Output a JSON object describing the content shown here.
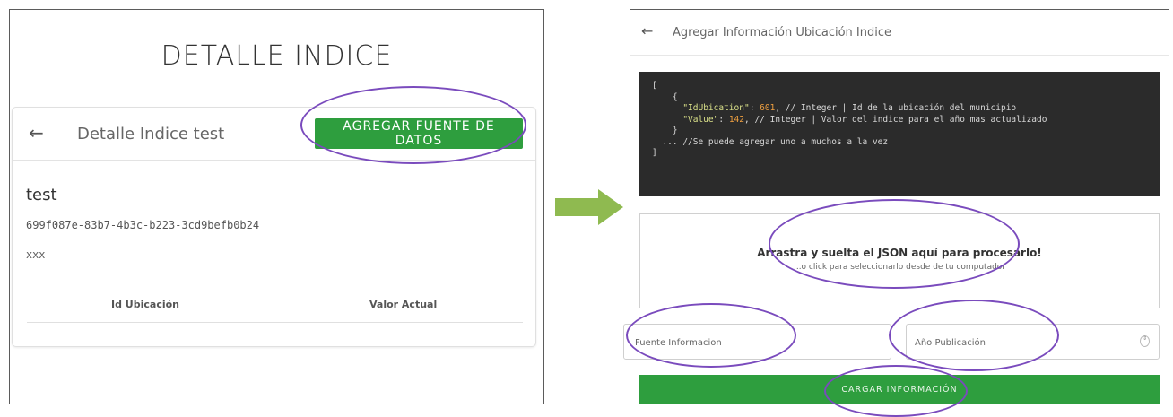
{
  "left": {
    "page_title": "DETALLE INDICE",
    "card_title": "Detalle Indice test",
    "add_button": "AGREGAR FUENTE DE DATOS",
    "index_name": "test",
    "index_id": "699f087e-83b7-4b3c-b223-3cd9befb0b24",
    "description": "xxx",
    "columns": [
      "Id Ubicación",
      "Valor Actual"
    ]
  },
  "right": {
    "header_title": "Agregar Información Ubicación Indice",
    "code": {
      "open_bracket": "[",
      "open_brace": "{",
      "key1": "\"IdUbication\"",
      "val1": "601",
      "comment1": ", // Integer | Id de la ubicación del municipio",
      "key2": "\"Value\"",
      "val2": "142",
      "comment2": ", // Integer | Valor del indice para el año mas actualizado",
      "close_brace": "}",
      "more": "... //Se puede agregar uno a muchos a la vez",
      "close_bracket": "]"
    },
    "dropzone_title": "Arrastra y suelta el JSON aquí para procesarlo!",
    "dropzone_subtitle": "...o click para seleccionarlo desde de tu computador",
    "field_source": "Fuente Informacion",
    "field_year": "Año Publicación",
    "load_button": "CARGAR INFORMACIÓN"
  },
  "icons": {
    "back": "arrow-left-icon",
    "transition": "arrow-right-icon",
    "number_spinner": "spinner-icon"
  },
  "colors": {
    "primary_button": "#2e9e3e",
    "highlight_ellipse": "#7a4bbd",
    "transition_arrow": "#8fba50",
    "code_background": "#2b2b2b"
  }
}
